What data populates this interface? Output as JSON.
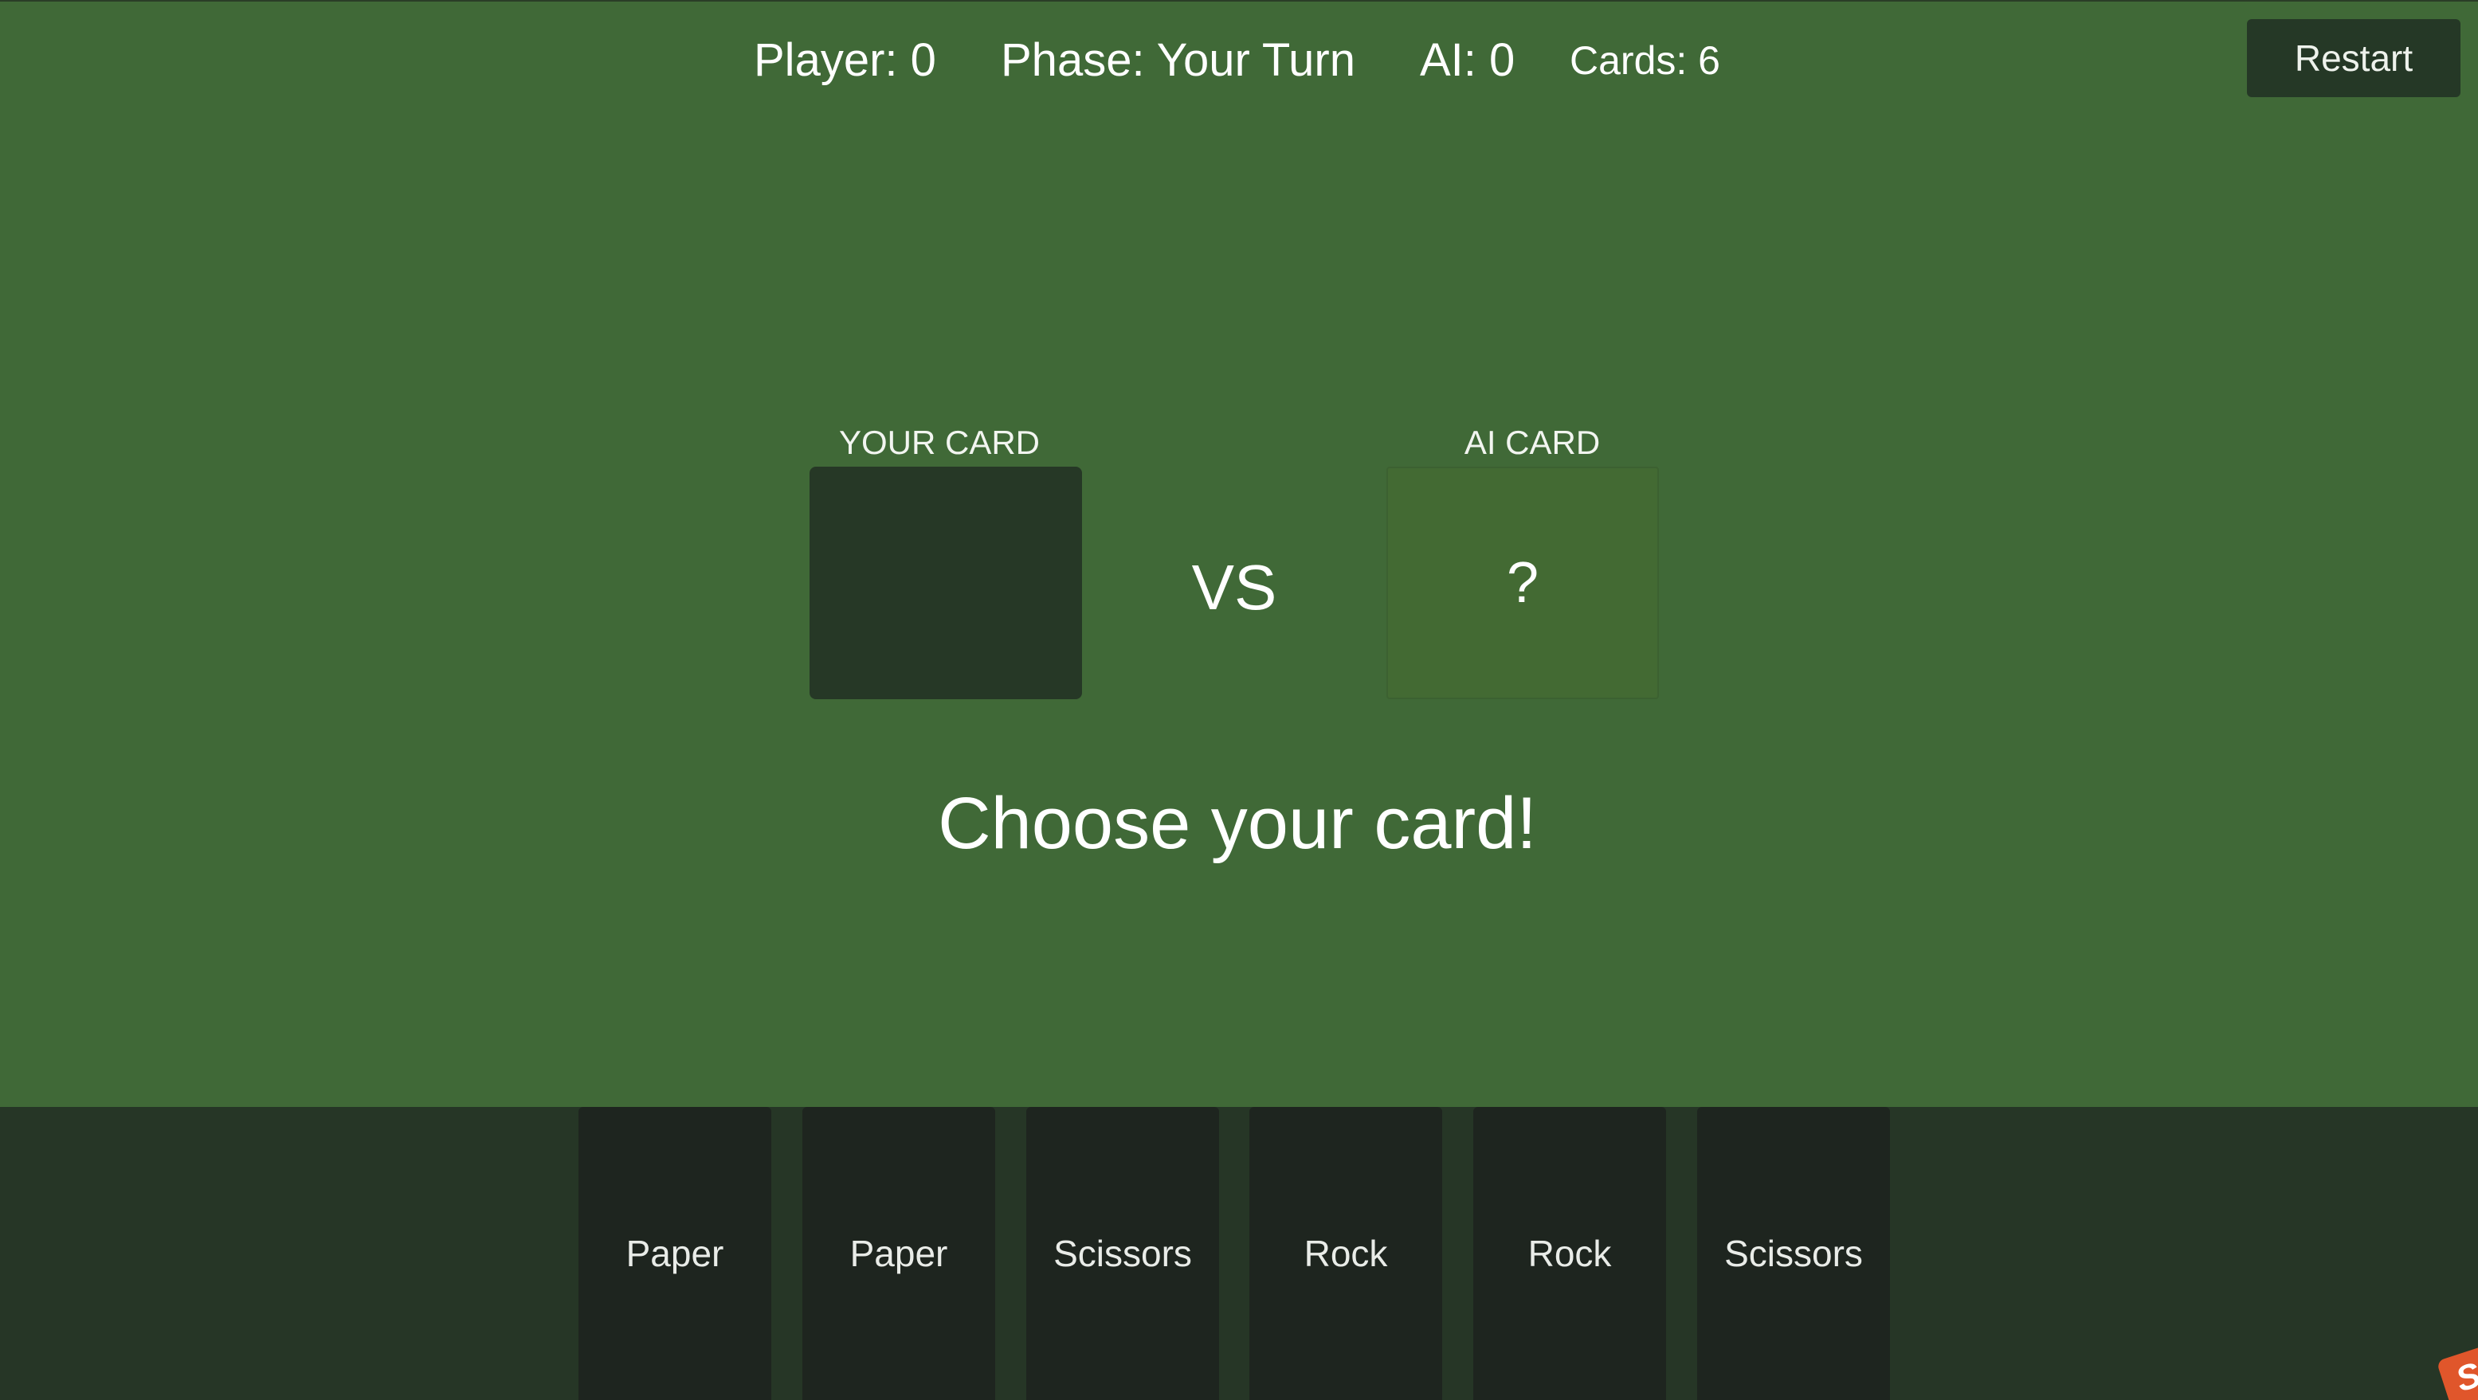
{
  "hud": {
    "player": "Player: 0",
    "phase": "Phase: Your Turn",
    "ai": "AI: 0",
    "cards": "Cards: 6"
  },
  "toolbar": {
    "restart_label": "Restart"
  },
  "battle": {
    "your_label": "YOUR CARD",
    "ai_label": "AI CARD",
    "ai_card_mark": "?",
    "vs": "VS",
    "status": "Choose your card!"
  },
  "hand": {
    "cards": [
      "Paper",
      "Paper",
      "Scissors",
      "Rock",
      "Rock",
      "Scissors"
    ]
  },
  "logo": {
    "glyph": "S"
  },
  "colors": {
    "table": "#406937",
    "tray": "#263626",
    "card": "#1e251f",
    "button": "#253826",
    "ai_slot": "#436a33",
    "logo": "#e0562b"
  }
}
